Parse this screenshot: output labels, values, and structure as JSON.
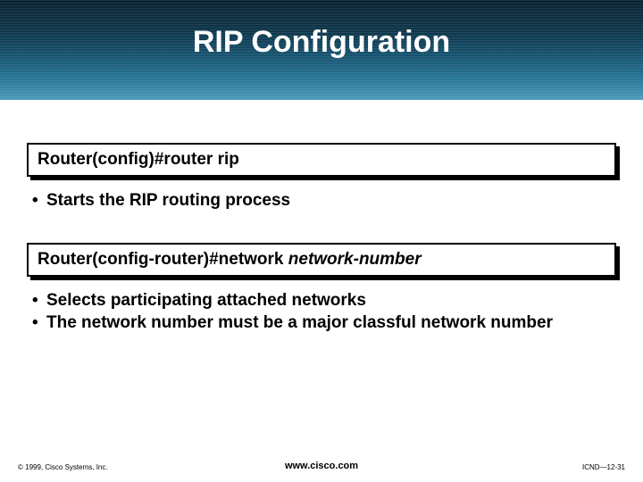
{
  "title": "RIP Configuration",
  "cmd1": "Router(config)#router rip",
  "bullets1": [
    "Starts the RIP routing process"
  ],
  "cmd2_prefix": "Router(config-router)#network ",
  "cmd2_italic": "network-number",
  "bullets2": [
    "Selects participating attached networks",
    "The network number must be a major classful network number"
  ],
  "footer": {
    "copyright": "© 1999, Cisco Systems, Inc.",
    "url": "www.cisco.com",
    "slidecode": "ICND—12-31"
  }
}
